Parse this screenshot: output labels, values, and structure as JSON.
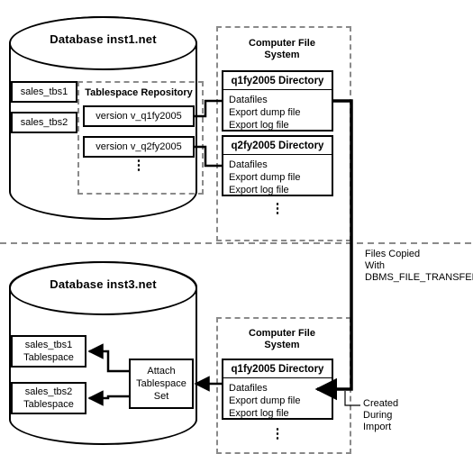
{
  "diagram": {
    "top": {
      "database": {
        "title": "Database inst1.net"
      },
      "tablespaces": [
        {
          "label": "sales_tbs1"
        },
        {
          "label": "sales_tbs2"
        }
      ],
      "repository": {
        "title": "Tablespace Repository",
        "versions": [
          {
            "label": "version v_q1fy2005"
          },
          {
            "label": "version v_q2fy2005"
          }
        ],
        "ellipsis": "⋮"
      },
      "file_system": {
        "title": "Computer File\nSystem",
        "title_line1": "Computer File",
        "title_line2": "System",
        "directories": [
          {
            "name": "q1fy2005 Directory",
            "contents": [
              "Datafiles",
              "Export dump file",
              "Export log file"
            ]
          },
          {
            "name": "q2fy2005 Directory",
            "contents": [
              "Datafiles",
              "Export dump file",
              "Export log file"
            ]
          }
        ],
        "ellipsis": "⋮"
      }
    },
    "transfer_note": {
      "line1": "Files Copied",
      "line2": "With",
      "line3": "DBMS_FILE_TRANSFER"
    },
    "bottom": {
      "database": {
        "title": "Database inst3.net"
      },
      "tablespaces": [
        {
          "line1": "sales_tbs1",
          "line2": "Tablespace"
        },
        {
          "line1": "sales_tbs2",
          "line2": "Tablespace"
        }
      ],
      "attach_box": {
        "line1": "Attach",
        "line2": "Tablespace",
        "line3": "Set"
      },
      "file_system": {
        "title_line1": "Computer File",
        "title_line2": "System",
        "directories": [
          {
            "name": "q1fy2005 Directory",
            "contents": [
              "Datafiles",
              "Export dump file",
              "Export log file"
            ]
          }
        ],
        "ellipsis": "⋮"
      },
      "created_note": {
        "line1": "Created",
        "line2": "During",
        "line3": "Import"
      }
    }
  }
}
